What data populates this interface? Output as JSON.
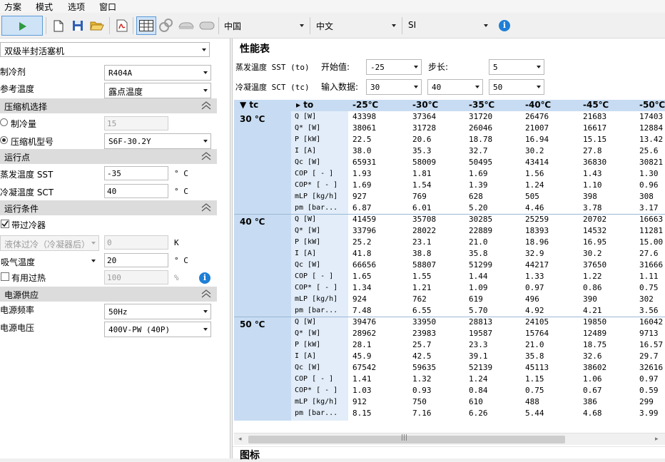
{
  "menu": [
    "方案",
    "模式",
    "选项",
    "窗口"
  ],
  "toolbar": {
    "region": "中国",
    "language": "中文",
    "units": "SI"
  },
  "left": {
    "compressor_type": "双级半封活塞机",
    "refrigerant_label": "制冷剂",
    "refrigerant_value": "R404A",
    "ref_temp_label": "参考温度",
    "ref_temp_value": "露点温度",
    "section_compressor": "压缩机选择",
    "capacity_label": "制冷量",
    "capacity_value": "15",
    "model_label": "压缩机型号",
    "model_value": "S6F-30.2Y",
    "section_operating_point": "运行点",
    "sst_label": "蒸发温度 SST",
    "sst_value": "-35",
    "sst_unit": "° C",
    "sct_label": "冷凝温度 SCT",
    "sct_value": "40",
    "sct_unit": "° C",
    "section_conditions": "运行条件",
    "subcooler_label": "带过冷器",
    "subcool_combo": "液体过冷（冷凝器后）",
    "subcool_value": "0",
    "subcool_unit": "K",
    "suction_label": "吸气温度",
    "suction_value": "20",
    "suction_unit": "° C",
    "superheat_label": "有用过热",
    "superheat_value": "100",
    "superheat_unit": "%",
    "section_power": "电源供应",
    "freq_label": "电源频率",
    "freq_value": "50Hz",
    "voltage_label": "电源电压",
    "voltage_value": "400V-PW (40P)"
  },
  "right": {
    "title": "性能表",
    "sst_label": "蒸发温度 SST (to)",
    "start_label": "开始值:",
    "start_value": "-25",
    "step_label": "步长:",
    "step_value": "5",
    "sct_label": "冷凝温度 SCT (tc)",
    "input_label": "输入数据:",
    "sct_values": [
      "30",
      "40",
      "50"
    ],
    "bottom_title": "图标"
  },
  "table": {
    "header_tc": "▼ tc",
    "header_to": "▸ to",
    "columns": [
      "-25℃",
      "-30℃",
      "-35℃",
      "-40℃",
      "-45℃",
      "-50℃"
    ],
    "row_labels": [
      "Q [W]",
      "Q* [W]",
      "P [kW]",
      "I [A]",
      "Qc [W]",
      "COP [ - ]",
      "COP* [ - ]",
      "mLP [kg/h]",
      "pm [bar..."
    ],
    "groups": [
      {
        "tc": "30 ℃",
        "rows": [
          [
            "43398",
            "37364",
            "31720",
            "26476",
            "21683",
            "17403"
          ],
          [
            "38061",
            "31728",
            "26046",
            "21007",
            "16617",
            "12884"
          ],
          [
            "22.5",
            "20.6",
            "18.78",
            "16.94",
            "15.15",
            "13.42"
          ],
          [
            "38.0",
            "35.3",
            "32.7",
            "30.2",
            "27.8",
            "25.6"
          ],
          [
            "65931",
            "58009",
            "50495",
            "43414",
            "36830",
            "30821"
          ],
          [
            "1.93",
            "1.81",
            "1.69",
            "1.56",
            "1.43",
            "1.30"
          ],
          [
            "1.69",
            "1.54",
            "1.39",
            "1.24",
            "1.10",
            "0.96"
          ],
          [
            "927",
            "769",
            "628",
            "505",
            "398",
            "308"
          ],
          [
            "6.87",
            "6.01",
            "5.20",
            "4.46",
            "3.78",
            "3.17"
          ]
        ]
      },
      {
        "tc": "40 ℃",
        "rows": [
          [
            "41459",
            "35708",
            "30285",
            "25259",
            "20702",
            "16663"
          ],
          [
            "33796",
            "28022",
            "22889",
            "18393",
            "14532",
            "11281"
          ],
          [
            "25.2",
            "23.1",
            "21.0",
            "18.96",
            "16.95",
            "15.00"
          ],
          [
            "41.8",
            "38.8",
            "35.8",
            "32.9",
            "30.2",
            "27.6"
          ],
          [
            "66656",
            "58807",
            "51299",
            "44217",
            "37650",
            "31666"
          ],
          [
            "1.65",
            "1.55",
            "1.44",
            "1.33",
            "1.22",
            "1.11"
          ],
          [
            "1.34",
            "1.21",
            "1.09",
            "0.97",
            "0.86",
            "0.75"
          ],
          [
            "924",
            "762",
            "619",
            "496",
            "390",
            "302"
          ],
          [
            "7.48",
            "6.55",
            "5.70",
            "4.92",
            "4.21",
            "3.56"
          ]
        ]
      },
      {
        "tc": "50 ℃",
        "rows": [
          [
            "39476",
            "33950",
            "28813",
            "24105",
            "19850",
            "16042"
          ],
          [
            "28962",
            "23983",
            "19587",
            "15764",
            "12489",
            "9713"
          ],
          [
            "28.1",
            "25.7",
            "23.3",
            "21.0",
            "18.75",
            "16.57"
          ],
          [
            "45.9",
            "42.5",
            "39.1",
            "35.8",
            "32.6",
            "29.7"
          ],
          [
            "67542",
            "59635",
            "52139",
            "45113",
            "38602",
            "32616"
          ],
          [
            "1.41",
            "1.32",
            "1.24",
            "1.15",
            "1.06",
            "0.97"
          ],
          [
            "1.03",
            "0.93",
            "0.84",
            "0.75",
            "0.67",
            "0.59"
          ],
          [
            "912",
            "750",
            "610",
            "488",
            "386",
            "299"
          ],
          [
            "8.15",
            "7.16",
            "6.26",
            "5.44",
            "4.68",
            "3.99"
          ]
        ]
      }
    ]
  },
  "colors": {
    "accent": "#c7dcf2",
    "selected_col": "#c2d8f0",
    "run_button": "#2d9a3e"
  }
}
